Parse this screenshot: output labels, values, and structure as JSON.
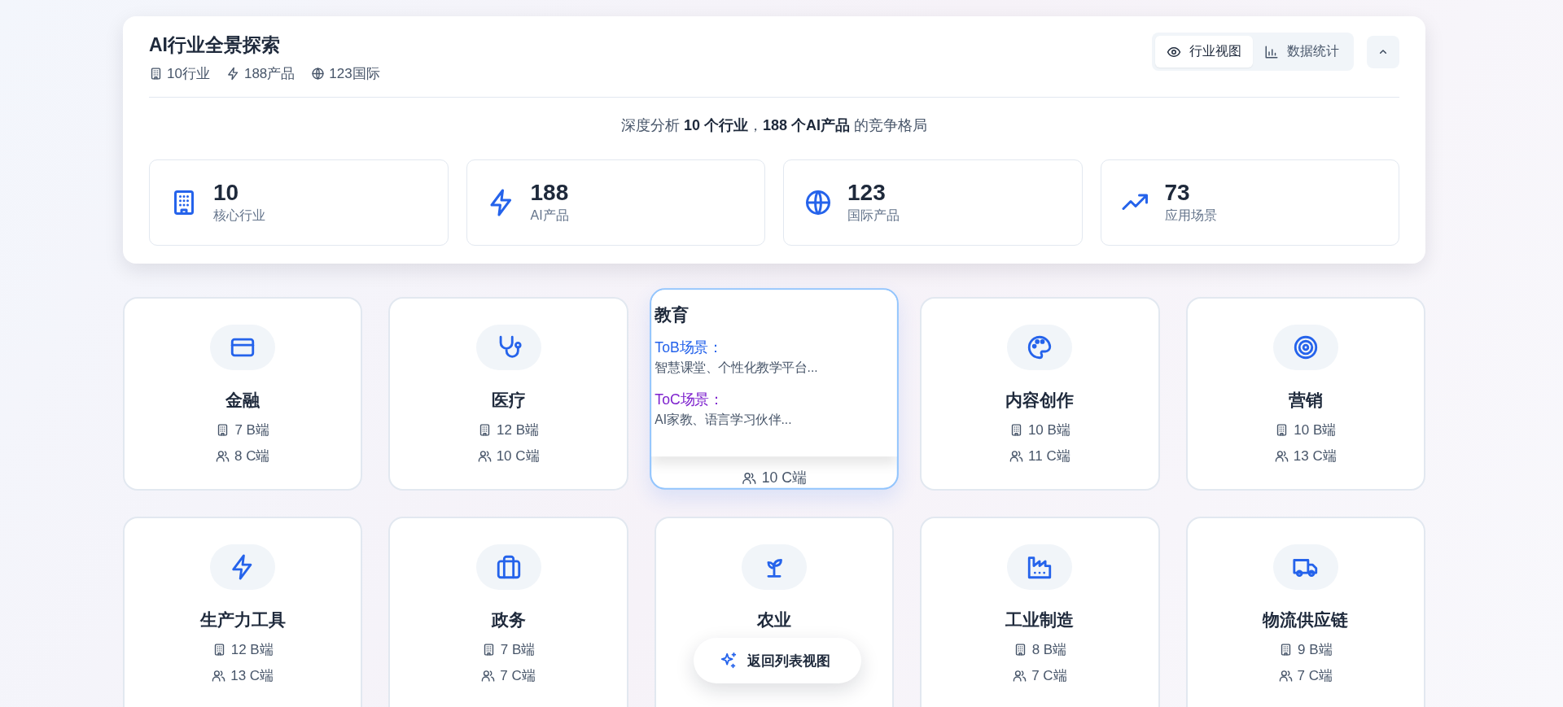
{
  "header": {
    "title": "AI行业全景探索",
    "meta": [
      "10行业",
      "188产品",
      "123国际"
    ],
    "view_tabs": [
      {
        "label": "行业视图",
        "selected": true
      },
      {
        "label": "数据统计",
        "selected": false
      }
    ],
    "collapse_button": {
      "expanded": true
    },
    "subtitle": "深度分析 **10 个行业**，**188 个AI产品** 的竞争格局",
    "stats": [
      {
        "value": "10",
        "label": "核心行业"
      },
      {
        "value": "188",
        "label": "AI产品"
      },
      {
        "value": "123",
        "label": "国际产品"
      },
      {
        "value": "73",
        "label": "应用场景"
      }
    ]
  },
  "industries": [
    {
      "name": "金融",
      "business": "7 B端",
      "consumer": "8 C端",
      "hovered": false
    },
    {
      "name": "医疗",
      "business": "12 B端",
      "consumer": "10 C端",
      "hovered": false
    },
    {
      "hovered": true,
      "consumer": "10 C端",
      "tooltip": {
        "title": "教育",
        "tob_label": "ToB场景：",
        "tob_text": "智慧课堂、个性化教学平台...",
        "toc_label": "ToC场景：",
        "toc_text": "AI家教、语言学习伙伴..."
      }
    },
    {
      "name": "内容创作",
      "business": "10 B端",
      "consumer": "11 C端",
      "hovered": false
    },
    {
      "name": "营销",
      "business": "10 B端",
      "consumer": "13 C端",
      "hovered": false
    },
    {
      "name": "生产力工具",
      "business": "12 B端",
      "consumer": "13 C端",
      "hovered": false
    },
    {
      "name": "政务",
      "business": "7 B端",
      "consumer": "7 C端",
      "hovered": false
    },
    {
      "name": "农业",
      "hovered": false
    },
    {
      "name": "工业制造",
      "business": "8 B端",
      "consumer": "7 C端",
      "hovered": false
    },
    {
      "name": "物流供应链",
      "business": "9 B端",
      "consumer": "7 C端",
      "hovered": false
    }
  ],
  "float_button": {
    "label": "返回列表视图"
  }
}
